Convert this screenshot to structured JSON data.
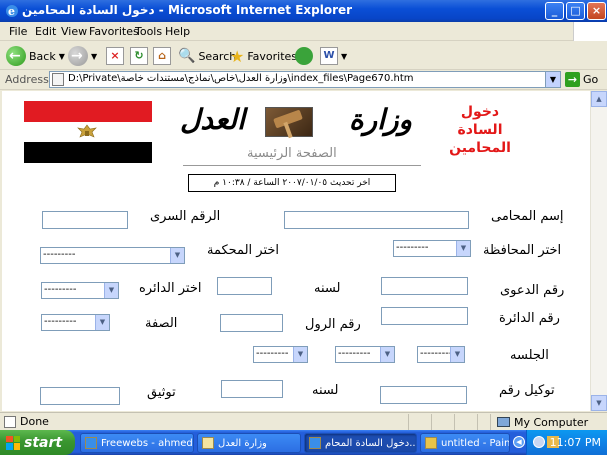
{
  "window": {
    "title": "دخول السادة المحامين - Microsoft Internet Explorer",
    "minimize": "_",
    "maximize": "□",
    "close": "×"
  },
  "menu": [
    "File",
    "Edit",
    "View",
    "Favorites",
    "Tools",
    "Help"
  ],
  "toolbar": {
    "back": "Back",
    "search": "Search",
    "favorites": "Favorites"
  },
  "address": {
    "label": "Address",
    "url": "D:\\Private\\وزارة العدل\\خاص\\نماذج\\مستندات خاصة\\index_files\\Page670.htm",
    "go": "Go"
  },
  "page": {
    "ministry_word1": "العدل",
    "ministry_word2": "وزارة",
    "home_link": "الصفحة الرئيسية",
    "login_line1": "دخول",
    "login_line2": "السادة المحامين",
    "update_text": "اخر تحديث ٢٠٠٧/٠١/٠٥   الساعة / ١٠:٣٨ م",
    "labels": {
      "lawyer_name": "إسم المحامى",
      "secret_number": "الرقم السرى",
      "governorate": "اختر المحافظة",
      "court": "اختر المحكمة",
      "case_number": "رقم الدعوى",
      "year1": "لسنه",
      "circuit_select": "اختر الدائره",
      "circuit_number": "رقم الدائرة",
      "roll_number": "رقم الرول",
      "capacity": "الصفة",
      "session": "الجلسه",
      "power_of_attorney": "توكيل رقم",
      "year2": "لسنه",
      "authentication": "توثيق"
    },
    "select_placeholder": "---------"
  },
  "status": {
    "text": "Done",
    "zone": "My Computer"
  },
  "taskbar": {
    "start": "start",
    "tasks": [
      "Freewebs - ahmed...",
      "وزارة العدل",
      "دخول السادة المحام...",
      "untitled - Paint"
    ],
    "clock": "11:07 PM"
  }
}
